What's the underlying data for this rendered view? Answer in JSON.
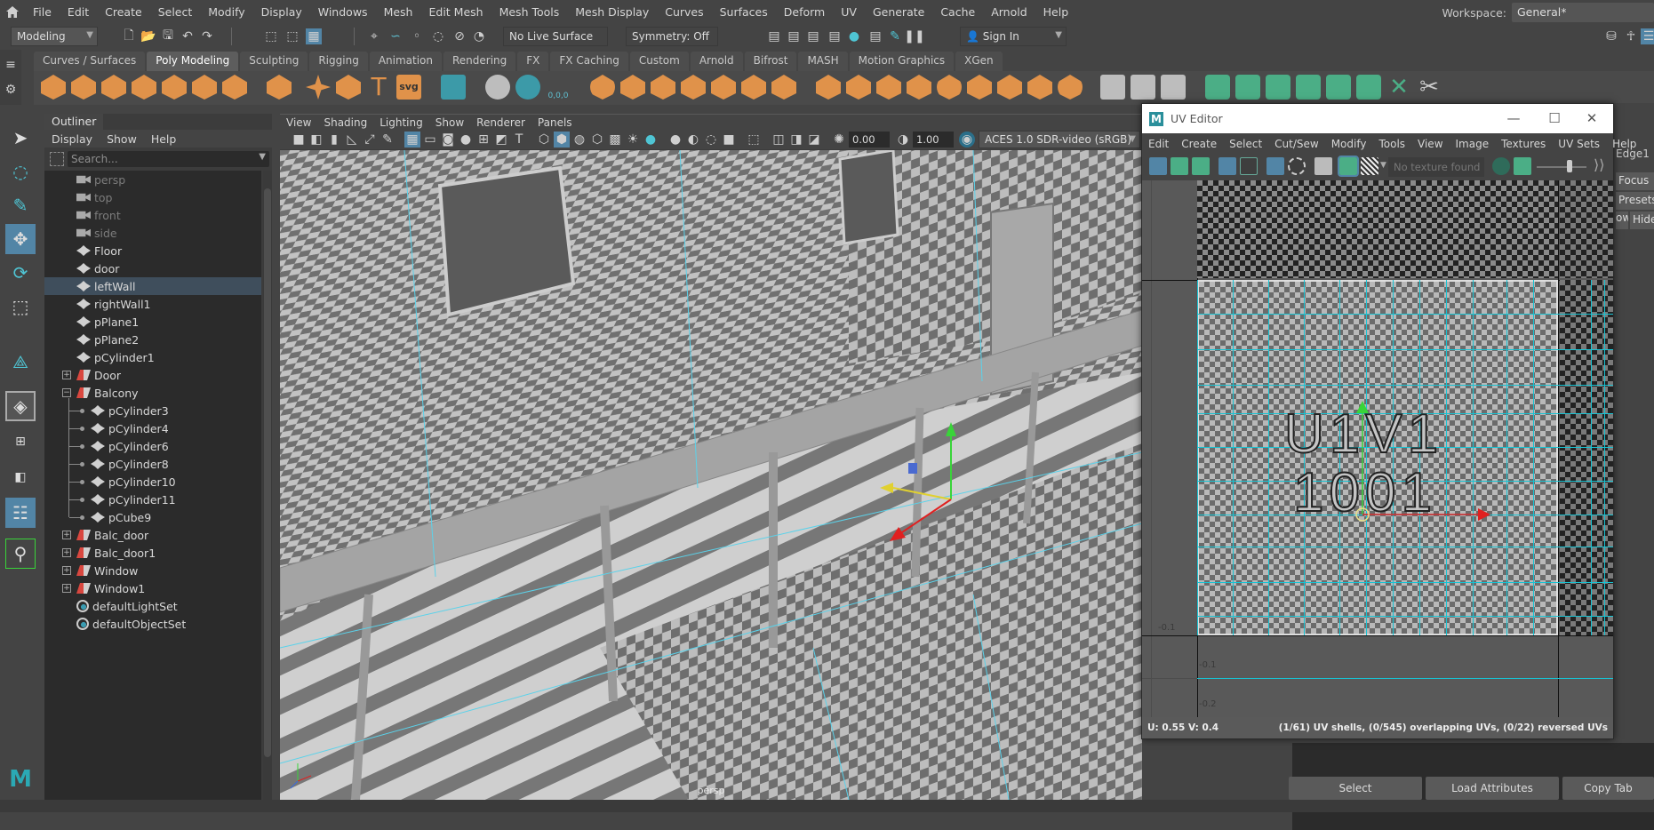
{
  "menubar": {
    "items": [
      "File",
      "Edit",
      "Create",
      "Select",
      "Modify",
      "Display",
      "Windows",
      "Mesh",
      "Edit Mesh",
      "Mesh Tools",
      "Mesh Display",
      "Curves",
      "Surfaces",
      "Deform",
      "UV",
      "Generate",
      "Cache",
      "Arnold",
      "Help"
    ],
    "workspace_label": "Workspace:",
    "workspace_value": "General*"
  },
  "statusline": {
    "mode": "Modeling",
    "live_surface": "No Live Surface",
    "symmetry": "Symmetry: Off",
    "sign_in": "Sign In"
  },
  "shelf": {
    "tabs": [
      "Curves / Surfaces",
      "Poly Modeling",
      "Sculpting",
      "Rigging",
      "Animation",
      "Rendering",
      "FX",
      "FX Caching",
      "Custom",
      "Arnold",
      "Bifrost",
      "MASH",
      "Motion Graphics",
      "XGen"
    ],
    "active_tab": "Poly Modeling",
    "snap_label": "0,0,0",
    "text_tool": "T",
    "svg_tool": "svg"
  },
  "outliner": {
    "title": "Outliner",
    "menus": [
      "Display",
      "Show",
      "Help"
    ],
    "search_placeholder": "Search...",
    "items": [
      {
        "label": "persp",
        "type": "camera",
        "dim": true,
        "level": 0
      },
      {
        "label": "top",
        "type": "camera",
        "dim": true,
        "level": 0
      },
      {
        "label": "front",
        "type": "camera",
        "dim": true,
        "level": 0
      },
      {
        "label": "side",
        "type": "camera",
        "dim": true,
        "level": 0
      },
      {
        "label": "Floor",
        "type": "mesh",
        "level": 0
      },
      {
        "label": "door",
        "type": "mesh",
        "level": 0
      },
      {
        "label": "leftWall",
        "type": "mesh",
        "level": 0,
        "selected": true
      },
      {
        "label": "rightWall1",
        "type": "mesh",
        "level": 0
      },
      {
        "label": "pPlane1",
        "type": "mesh",
        "level": 0
      },
      {
        "label": "pPlane2",
        "type": "mesh",
        "level": 0
      },
      {
        "label": "pCylinder1",
        "type": "mesh",
        "level": 0
      },
      {
        "label": "Door",
        "type": "group",
        "level": 0,
        "expander": "+"
      },
      {
        "label": "Balcony",
        "type": "group",
        "level": 0,
        "expander": "-"
      },
      {
        "label": "pCylinder3",
        "type": "mesh",
        "level": 1
      },
      {
        "label": "pCylinder4",
        "type": "mesh",
        "level": 1
      },
      {
        "label": "pCylinder6",
        "type": "mesh",
        "level": 1
      },
      {
        "label": "pCylinder8",
        "type": "mesh",
        "level": 1
      },
      {
        "label": "pCylinder10",
        "type": "mesh",
        "level": 1
      },
      {
        "label": "pCylinder11",
        "type": "mesh",
        "level": 1
      },
      {
        "label": "pCube9",
        "type": "mesh",
        "level": 1
      },
      {
        "label": "Balc_door",
        "type": "group",
        "level": 0,
        "expander": "+"
      },
      {
        "label": "Balc_door1",
        "type": "group",
        "level": 0,
        "expander": "+"
      },
      {
        "label": "Window",
        "type": "group",
        "level": 0,
        "expander": "+"
      },
      {
        "label": "Window1",
        "type": "group",
        "level": 0,
        "expander": "+"
      },
      {
        "label": "defaultLightSet",
        "type": "set",
        "level": 0
      },
      {
        "label": "defaultObjectSet",
        "type": "set",
        "level": 0
      }
    ]
  },
  "viewport": {
    "menus": [
      "View",
      "Shading",
      "Lighting",
      "Show",
      "Renderer",
      "Panels"
    ],
    "exposure": "0.00",
    "gamma": "1.00",
    "color_space": "ACES 1.0 SDR-video (sRGB)",
    "camera_label": "persp"
  },
  "uv_editor": {
    "title": "UV Editor",
    "menus": [
      "Edit",
      "Create",
      "Select",
      "Cut/Sew",
      "Modify",
      "Tools",
      "View",
      "Image",
      "Textures",
      "UV Sets",
      "Help"
    ],
    "texture_placeholder": "No texture found",
    "tile_text_line1": "U1V1",
    "tile_text_line2": "1001",
    "axis_labels": [
      "-0.1",
      "-0.1",
      "-0.2"
    ],
    "status_uv": "U:  0.55 V:  0.4",
    "status_info": "(1/61) UV shells, (0/545) overlapping UVs, (0/22) reversed UVs"
  },
  "right_panel": {
    "partial_labels": [
      "Edge1",
      "Focus",
      "Presets",
      "ow",
      "Hide"
    ],
    "buttons": [
      "Select",
      "Load Attributes",
      "Copy Tab"
    ]
  },
  "colors": {
    "accent_blue": "#5285a6",
    "uv_grid_cyan": "#18c2d2",
    "shelf_orange": "#e0924a",
    "shelf_green": "#4bae86",
    "selection_row": "#3f4e5c"
  }
}
